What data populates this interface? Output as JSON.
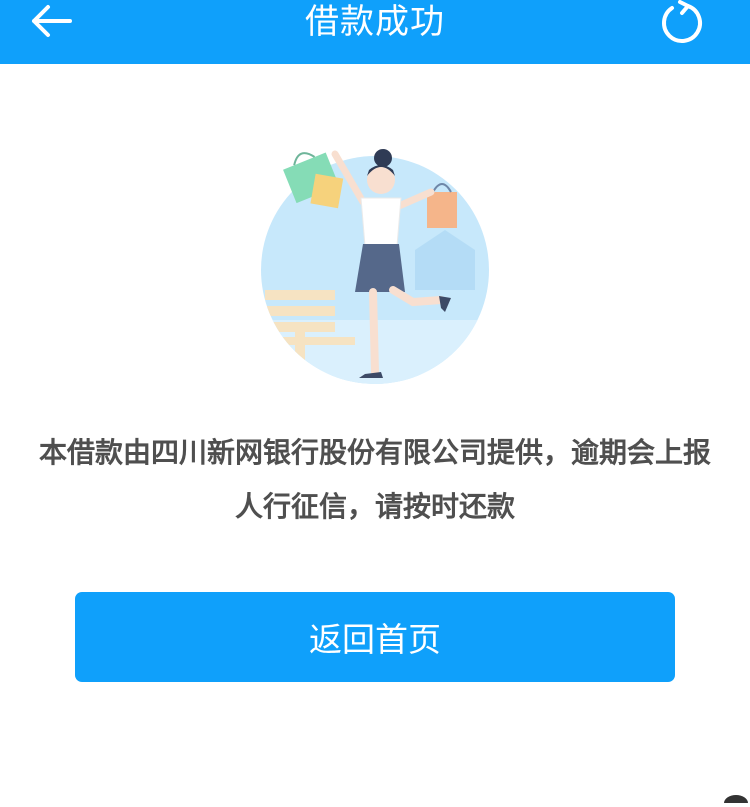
{
  "header": {
    "title": "借款成功",
    "back_icon": "arrow-left-icon",
    "refresh_icon": "refresh-icon",
    "background": "#0fa0fb"
  },
  "illustration": {
    "icon": "celebrating-shopper-illustration"
  },
  "notice": {
    "line1": "本借款由四川新网银行股份有限公司提供，逾期会上报",
    "line2": "人行征信，请按时还款"
  },
  "actions": {
    "home_label": "返回首页",
    "accent": "#0fa0fb"
  }
}
